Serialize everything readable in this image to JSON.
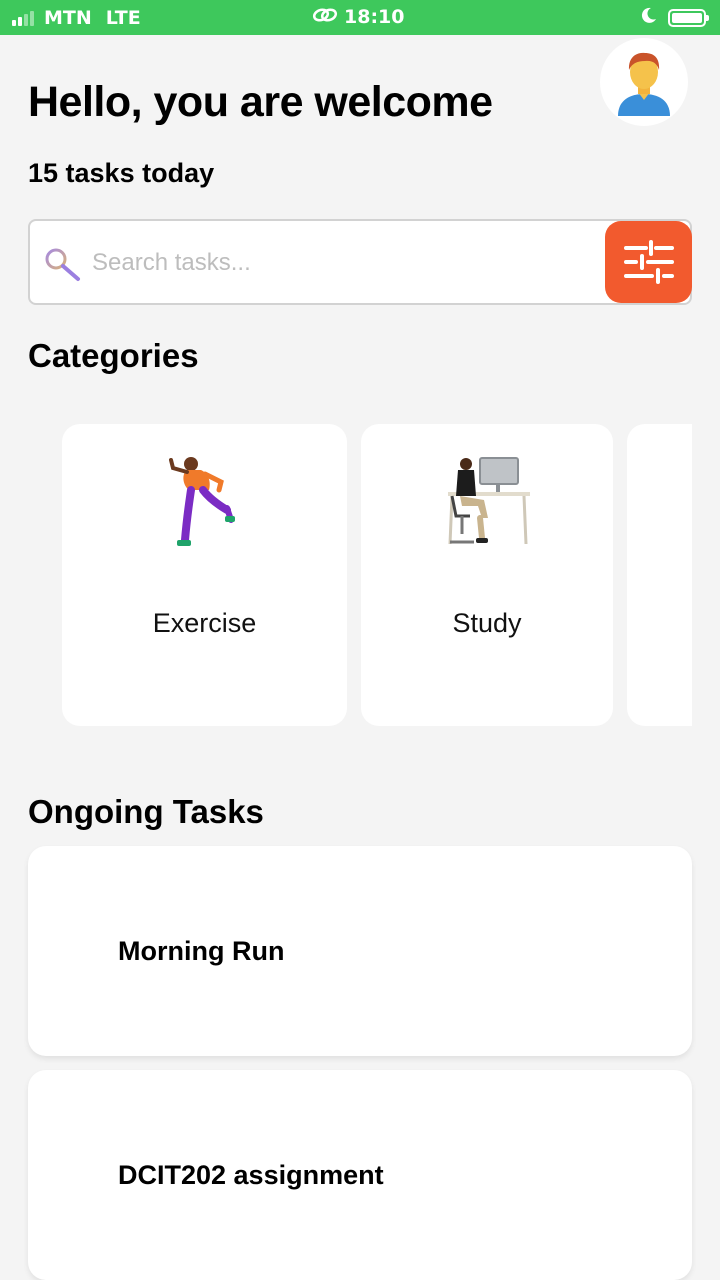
{
  "status_bar": {
    "carrier": "MTN",
    "network": "LTE",
    "time": "18:10",
    "icons": [
      "signal-icon",
      "link-icon",
      "moon-icon",
      "battery-icon"
    ],
    "color": "#3ec85c"
  },
  "header": {
    "greeting": "Hello, you are welcome",
    "task_count_text": "15 tasks today",
    "avatar_icon": "user-avatar-icon"
  },
  "search": {
    "placeholder": "Search tasks...",
    "value": "",
    "icon": "search-icon",
    "filter_icon": "sliders-icon",
    "filter_color": "#f25a2e"
  },
  "categories": {
    "title": "Categories",
    "items": [
      {
        "label": "Exercise",
        "icon": "running-person-illustration"
      },
      {
        "label": "Study",
        "icon": "person-at-desk-illustration"
      },
      {
        "label": "",
        "icon": ""
      }
    ]
  },
  "ongoing": {
    "title": "Ongoing Tasks",
    "items": [
      {
        "title": "Morning Run"
      },
      {
        "title": "DCIT202 assignment"
      }
    ]
  }
}
